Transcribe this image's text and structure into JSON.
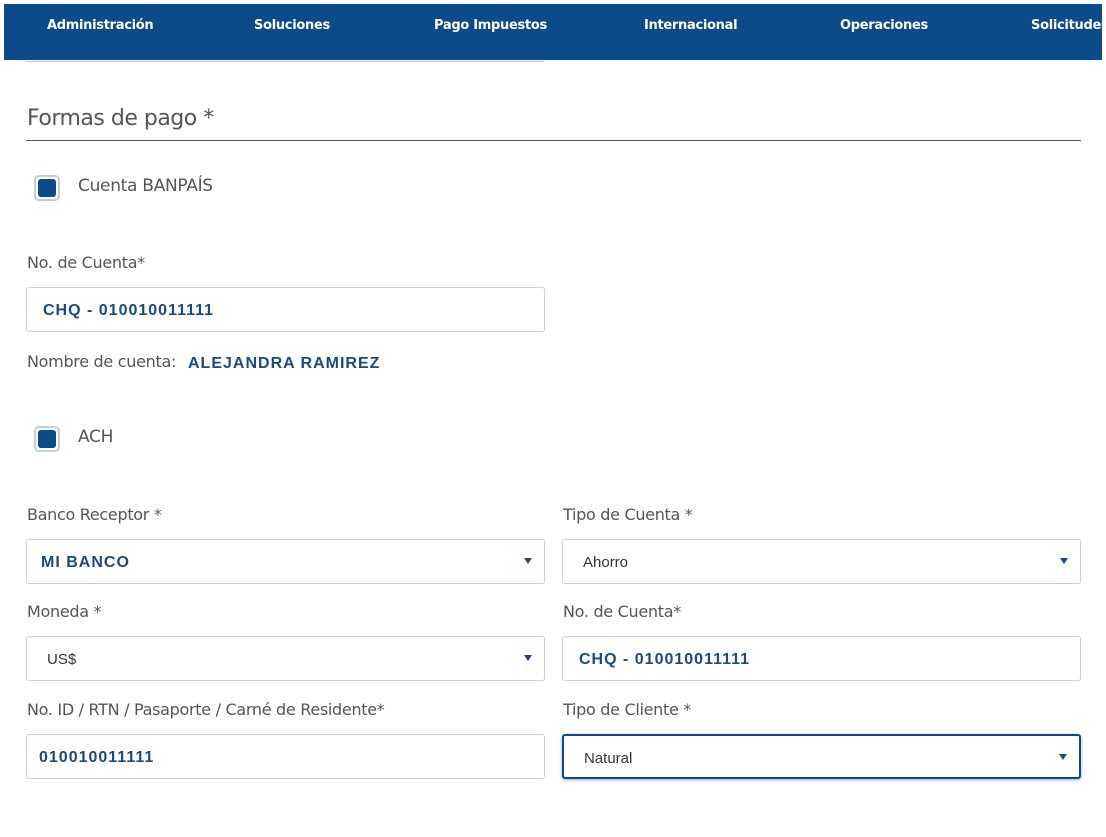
{
  "nav": {
    "items": [
      "Administración",
      "Soluciones",
      "Pago Impuestos",
      "Internacional",
      "Operaciones",
      "Solicitudes"
    ]
  },
  "section": {
    "title": "Formas de pago *"
  },
  "cuenta_banpais": {
    "checkbox_label": "Cuenta BANPAÍS",
    "account_label": "No. de Cuenta*",
    "account_value": "CHQ - 010010011111",
    "name_label": "Nombre de cuenta:",
    "name_value": "ALEJANDRA RAMIREZ"
  },
  "ach": {
    "checkbox_label": "ACH",
    "banco_label": "Banco Receptor *",
    "banco_value": "MI BANCO",
    "tipo_cuenta_label": "Tipo de Cuenta *",
    "tipo_cuenta_value": "Ahorro",
    "moneda_label": "Moneda *",
    "moneda_value": "US$",
    "account_label": "No. de Cuenta*",
    "account_value": "CHQ - 010010011111",
    "id_label": "No. ID / RTN / Pasaporte / Carné de Residente*",
    "id_value": "010010011111",
    "tipo_cliente_label": "Tipo de Cliente *",
    "tipo_cliente_value": "Natural"
  },
  "colors": {
    "brand": "#0c4a8a",
    "value_text": "#1a4a80"
  }
}
